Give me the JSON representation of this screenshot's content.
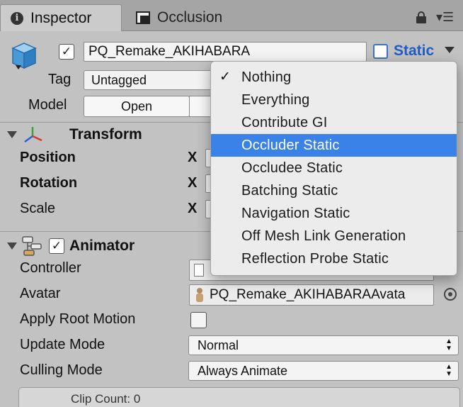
{
  "tabs": {
    "inspector": "Inspector",
    "occlusion": "Occlusion"
  },
  "header": {
    "object_name": "PQ_Remake_AKIHABARA",
    "active_checked": "✓",
    "static_label": "Static",
    "tag_label": "Tag",
    "tag_value": "Untagged",
    "model_label": "Model",
    "open_label": "Open"
  },
  "transform": {
    "title": "Transform",
    "position_label": "Position",
    "rotation_label": "Rotation",
    "scale_label": "Scale",
    "x_label": "X"
  },
  "animator": {
    "title": "Animator",
    "enabled_checked": "✓",
    "controller_label": "Controller",
    "avatar_label": "Avatar",
    "avatar_value": "PQ_Remake_AKIHABARAAvata",
    "apply_root_motion_label": "Apply Root Motion",
    "update_mode_label": "Update Mode",
    "update_mode_value": "Normal",
    "culling_mode_label": "Culling Mode",
    "culling_mode_value": "Always Animate",
    "clip_count": "Clip Count: 0"
  },
  "static_menu": {
    "items": [
      {
        "label": "Nothing",
        "check": "✓"
      },
      {
        "label": "Everything",
        "check": ""
      },
      {
        "label": "Contribute GI",
        "check": ""
      },
      {
        "label": "Occluder Static",
        "check": ""
      },
      {
        "label": "Occludee Static",
        "check": ""
      },
      {
        "label": "Batching Static",
        "check": ""
      },
      {
        "label": "Navigation Static",
        "check": ""
      },
      {
        "label": "Off Mesh Link Generation",
        "check": ""
      },
      {
        "label": "Reflection Probe Static",
        "check": ""
      }
    ],
    "selected_index": 3
  },
  "colors": {
    "panel_bg": "#c2c2c2",
    "accent_blue": "#3b82e8",
    "static_blue": "#1f5dc2"
  },
  "icons": {
    "inspector_tab": "info-icon",
    "occlusion_tab": "occlusion-icon",
    "lock": "lock-icon",
    "menu": "tab-menu-icon",
    "object": "cube-icon",
    "transform": "transform-axes-icon",
    "animator": "animator-icon",
    "avatar": "avatar-icon",
    "object_picker": "object-picker-icon"
  }
}
